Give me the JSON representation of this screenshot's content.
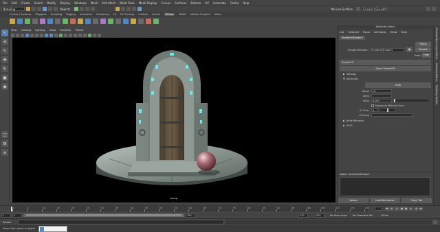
{
  "menubar": {
    "items": [
      "File",
      "Edit",
      "Create",
      "Select",
      "Modify",
      "Display",
      "Windows",
      "Mesh",
      "Edit Mesh",
      "Mesh Tools",
      "Mesh Display",
      "Curves",
      "Surfaces",
      "Deform",
      "UV",
      "Generate",
      "Cache",
      "Help"
    ]
  },
  "statusline": {
    "mode": "Modeling",
    "objects_label": "Objects",
    "live_surface": "No Live Surface",
    "search_value": "ShaderfxShader1"
  },
  "shelf": {
    "tabs": [
      "Curves / Surfaces",
      "Polygons",
      "Sculpting",
      "Rigging",
      "Animation",
      "Rendering",
      "FX",
      "FX Caching",
      "Custom",
      "Arnold",
      "Bifrost",
      "MASH",
      "Motion Graphics",
      "XGen"
    ],
    "active_tab": "Bifrost"
  },
  "viewport": {
    "menu": [
      "View",
      "Shading",
      "Lighting",
      "Show",
      "Renderer",
      "Panels"
    ],
    "camera": "persp"
  },
  "attribute_editor": {
    "window_title": "Attribute Editor",
    "menu": [
      "List",
      "Selected",
      "Focus",
      "Attributes",
      "Show",
      "Help"
    ],
    "tab": "ShaderfxShader1",
    "shader_label": "ShaderfxShader:",
    "shader_value": "ShaderfxShader1",
    "focus_btn": "Focus",
    "presets_btn": "Presets",
    "show_btn": "Show",
    "hide_btn": "Hide",
    "section_main": "ShaderFX",
    "open_btn": "Open ShaderFX",
    "settings_label": "Settings",
    "attributes_label": "Attributes",
    "help_btn": "Help",
    "attrs": [
      {
        "label": "Name",
        "value": "Lit"
      },
      {
        "label": "Show",
        "value": ""
      },
      {
        "label": "Value",
        "value": "0.000"
      },
      {
        "label": "",
        "value": "Expose as Material Input"
      },
      {
        "label": "UI Order",
        "value": "0"
      },
      {
        "label": "UI Group",
        "value": ""
      }
    ],
    "section_node_behavior": "Node Behavior",
    "section_uuid": "UUID",
    "notes_title": "Notes: ShaderfxShader1",
    "bottom_buttons": [
      "Select",
      "Load Attributes",
      "Copy Tab"
    ]
  },
  "right_tabs": [
    "Channel Box / Layer Editor",
    "Attribute Editor",
    "Modeling Toolkit"
  ],
  "timeslider": {
    "ticks": [
      "1",
      "5",
      "10",
      "15",
      "20",
      "25",
      "30",
      "35",
      "40",
      "45",
      "50",
      "55",
      "60",
      "65",
      "70",
      "75",
      "80",
      "85",
      "90",
      "95",
      "100",
      "105",
      "110",
      "115",
      "120"
    ],
    "current_frame": "1"
  },
  "range": {
    "start": "1",
    "start_inner": "1",
    "end_inner": "120",
    "end": "120",
    "end_outer": "200",
    "anim_layer": "No Anim Layer",
    "char_set": "No Character Set",
    "fps": "24 fps"
  },
  "cmdline": {
    "label": "Python"
  },
  "helpline": {
    "text": "Select Tool: select an object"
  },
  "colors": {
    "accent": "#5d7ea8",
    "rune_glow": "#5ff0ee",
    "bg": "#444444"
  }
}
